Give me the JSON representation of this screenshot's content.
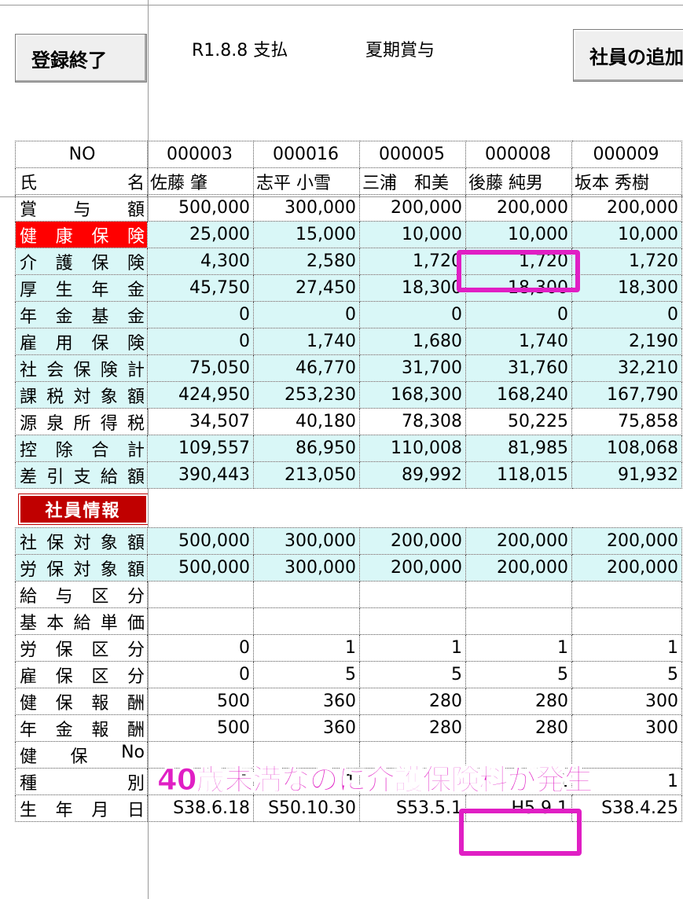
{
  "toolbar": {
    "finish_label": "登録終了",
    "date_text": "R1.8.8 支払",
    "type_text": "夏期賞与",
    "add_label": "社員の追加"
  },
  "employees": [
    {
      "no": "000003",
      "name": "佐藤 肇"
    },
    {
      "no": "000016",
      "name": "志平 小雪"
    },
    {
      "no": "000005",
      "name": "三浦　和美"
    },
    {
      "no": "000008",
      "name": "後藤 純男"
    },
    {
      "no": "000009",
      "name": "坂本 秀樹"
    }
  ],
  "labels": {
    "no": "NO",
    "name": [
      "氏",
      "名"
    ]
  },
  "payroll_rows": [
    {
      "label": [
        "賞",
        "与",
        "額"
      ],
      "values": [
        "500,000",
        "300,000",
        "200,000",
        "200,000",
        "200,000"
      ],
      "style": "plain"
    },
    {
      "label": [
        "健",
        "康",
        "保",
        "険"
      ],
      "values": [
        "25,000",
        "15,000",
        "10,000",
        "10,000",
        "10,000"
      ],
      "style": "red"
    },
    {
      "label": [
        "介",
        "護",
        "保",
        "険"
      ],
      "values": [
        "4,300",
        "2,580",
        "1,720",
        "1,720",
        "1,720"
      ],
      "style": "cyan"
    },
    {
      "label": [
        "厚",
        "生",
        "年",
        "金"
      ],
      "values": [
        "45,750",
        "27,450",
        "18,300",
        "18,300",
        "18,300"
      ],
      "style": "cyan"
    },
    {
      "label": [
        "年",
        "金",
        "基",
        "金"
      ],
      "values": [
        "0",
        "0",
        "0",
        "0",
        "0"
      ],
      "style": "cyan"
    },
    {
      "label": [
        "雇",
        "用",
        "保",
        "険"
      ],
      "values": [
        "0",
        "1,740",
        "1,680",
        "1,740",
        "2,190"
      ],
      "style": "cyan"
    },
    {
      "label": [
        "社",
        "会",
        "保",
        "険",
        "計"
      ],
      "values": [
        "75,050",
        "46,770",
        "31,700",
        "31,760",
        "32,210"
      ],
      "style": "cyan"
    },
    {
      "label": [
        "課",
        "税",
        "対",
        "象",
        "額"
      ],
      "values": [
        "424,950",
        "253,230",
        "168,300",
        "168,240",
        "167,790"
      ],
      "style": "cyan"
    },
    {
      "label": [
        "源",
        "泉",
        "所",
        "得",
        "税"
      ],
      "values": [
        "34,507",
        "40,180",
        "78,308",
        "50,225",
        "75,858"
      ],
      "style": "plain"
    },
    {
      "label": [
        "控",
        "除",
        "合",
        "計"
      ],
      "values": [
        "109,557",
        "86,950",
        "110,008",
        "81,985",
        "108,068"
      ],
      "style": "cyan"
    },
    {
      "label": [
        "差",
        "引",
        "支",
        "給",
        "額"
      ],
      "values": [
        "390,443",
        "213,050",
        "89,992",
        "118,015",
        "91,932"
      ],
      "style": "cyan"
    }
  ],
  "section_label": "社員情報",
  "info_rows": [
    {
      "label": [
        "社",
        "保",
        "対",
        "象",
        "額"
      ],
      "values": [
        "500,000",
        "300,000",
        "200,000",
        "200,000",
        "200,000"
      ],
      "style": "cyan"
    },
    {
      "label": [
        "労",
        "保",
        "対",
        "象",
        "額"
      ],
      "values": [
        "500,000",
        "300,000",
        "200,000",
        "200,000",
        "200,000"
      ],
      "style": "cyan"
    },
    {
      "label": [
        "給",
        "与",
        "区",
        "分"
      ],
      "values": [
        "",
        "",
        "",
        "",
        ""
      ],
      "style": "plain"
    },
    {
      "label": [
        "基",
        "本",
        "給",
        "単",
        "価"
      ],
      "values": [
        "",
        "",
        "",
        "",
        ""
      ],
      "style": "plain"
    },
    {
      "label": [
        "労",
        "保",
        "区",
        "分"
      ],
      "values": [
        "0",
        "1",
        "1",
        "1",
        "1"
      ],
      "style": "plain"
    },
    {
      "label": [
        "雇",
        "保",
        "区",
        "分"
      ],
      "values": [
        "0",
        "5",
        "5",
        "5",
        "5"
      ],
      "style": "plain"
    },
    {
      "label": [
        "健",
        "保",
        "報",
        "酬"
      ],
      "values": [
        "500",
        "360",
        "280",
        "280",
        "300"
      ],
      "style": "plain"
    },
    {
      "label": [
        "年",
        "金",
        "報",
        "酬"
      ],
      "values": [
        "500",
        "360",
        "280",
        "280",
        "300"
      ],
      "style": "plain"
    },
    {
      "label": [
        "健",
        "保",
        "No"
      ],
      "values": [
        "",
        "",
        "",
        "",
        ""
      ],
      "style": "plain"
    },
    {
      "label": [
        "種",
        "別"
      ],
      "values": [
        "1",
        "1",
        "1",
        "1",
        "1"
      ],
      "style": "plain"
    },
    {
      "label": [
        "生",
        "年",
        "月",
        "日"
      ],
      "values": [
        "S38.6.18",
        "S50.10.30",
        "S53.5.1",
        "H5.9.1",
        "S38.4.25"
      ],
      "style": "plain"
    }
  ],
  "annotation": "40歳未満なのに介護保険料が発生",
  "colors": {
    "highlight": "#e01fc4",
    "cyan": "#d9f7f7",
    "red": "#ff0000",
    "badge": "#c00000"
  }
}
